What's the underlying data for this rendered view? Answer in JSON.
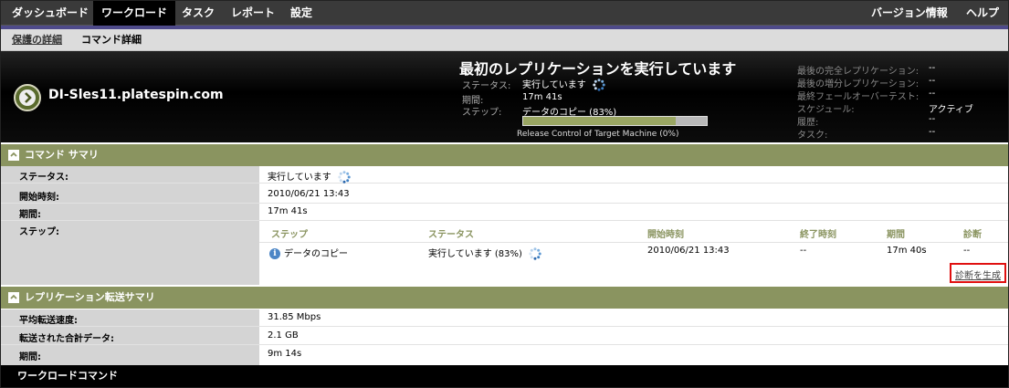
{
  "nav": {
    "items": [
      {
        "label": "ダッシュボード"
      },
      {
        "label": "ワークロード"
      },
      {
        "label": "タスク"
      },
      {
        "label": "レポート"
      },
      {
        "label": "設定"
      }
    ],
    "right": [
      {
        "label": "バージョン情報"
      },
      {
        "label": "ヘルプ"
      }
    ]
  },
  "subnav": {
    "protection_details": "保護の詳細",
    "command_details": "コマンド詳細"
  },
  "header": {
    "workload_name": "DI-Sles11.platespin.com",
    "title": "最初のレプリケーションを実行しています",
    "status_label": "ステータス:",
    "status_value": "実行しています",
    "duration_label": "期間:",
    "duration_value": "17m 41s",
    "step_label": "ステップ:",
    "step_value": "データのコピー (83%)",
    "progress": 0.83,
    "progress_caption": "Release Control of Target Machine (0%)",
    "right": [
      {
        "label": "最後の完全レプリケーション:",
        "value": "--"
      },
      {
        "label": "最後の増分レプリケーション:",
        "value": "--"
      },
      {
        "label": "最終フェールオーバーテスト:",
        "value": "--"
      },
      {
        "label": "スケジュール:",
        "value": "アクティブ"
      },
      {
        "label": "履歴:",
        "value": "--"
      },
      {
        "label": "タスク:",
        "value": "--"
      }
    ]
  },
  "command_summary": {
    "title": "コマンド サマリ",
    "status_label": "ステータス:",
    "status_value": "実行しています",
    "start_label": "開始時刻:",
    "start_value": "2010/06/21 13:43",
    "duration_label": "期間:",
    "duration_value": "17m 41s",
    "steps_label": "ステップ:",
    "steps_table": {
      "headers": [
        "ステップ",
        "ステータス",
        "開始時刻",
        "終了時刻",
        "期間",
        "診断"
      ],
      "rows": [
        {
          "step": "データのコピー",
          "status": "実行しています (83%)",
          "start": "2010/06/21 13:43",
          "end": "--",
          "duration": "17m 40s",
          "diag": "--"
        }
      ]
    },
    "generate_diagnostics": "診断を生成"
  },
  "transfer_summary": {
    "title": "レプリケーション転送サマリ",
    "rate_label": "平均転送速度:",
    "rate_value": "31.85 Mbps",
    "total_label": "転送された合計データ:",
    "total_value": "2.1 GB",
    "duration_label": "期間:",
    "duration_value": "9m 14s"
  },
  "footer": {
    "title": "ワークロードコマンド"
  },
  "colors": {
    "section_bar": "#8a9460",
    "nav_purple": "#4e4a8a",
    "highlight_box": "#e01010"
  }
}
